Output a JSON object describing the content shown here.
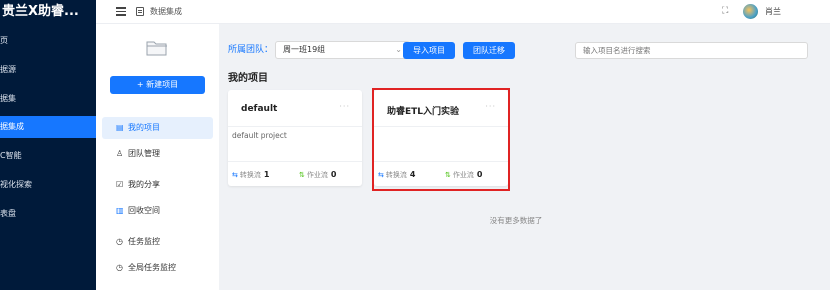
{
  "sidebar": {
    "brand": "贵兰X助睿...",
    "items": [
      {
        "label": "页"
      },
      {
        "label": "据源"
      },
      {
        "label": "据集"
      },
      {
        "label": "据集成"
      },
      {
        "label": "C智能"
      },
      {
        "label": "视化探索"
      },
      {
        "label": "表盘"
      }
    ]
  },
  "header": {
    "title": "数据集成",
    "user_name": "肖兰"
  },
  "subnav": {
    "new_project_label": "+ 新建项目",
    "items": [
      {
        "label": "我的项目",
        "icon": "project-icon"
      },
      {
        "label": "团队管理",
        "icon": "user-icon"
      },
      {
        "label": "我的分享",
        "icon": "share-icon"
      },
      {
        "label": "回收空间",
        "icon": "trash-icon"
      },
      {
        "label": "任务监控",
        "icon": "clock-icon"
      },
      {
        "label": "全局任务监控",
        "icon": "clock-icon"
      }
    ]
  },
  "main": {
    "team_label": "所属团队：",
    "team_value": "周一班19组",
    "import_button": "导入项目",
    "migrate_button": "团队迁移",
    "search_placeholder": "输入项目名进行搜索",
    "section_title": "我的项目",
    "no_more_text": "没有更多数据了",
    "cards": [
      {
        "title": "default",
        "more": "···",
        "description": "default project",
        "flow_label": "转换流",
        "flow_count": "1",
        "job_label": "作业流",
        "job_count": "0"
      },
      {
        "title": "助睿ETL入门实验",
        "more": "···",
        "description": "",
        "flow_label": "转换流",
        "flow_count": "4",
        "job_label": "作业流",
        "job_count": "0"
      }
    ]
  },
  "colors": {
    "sidebar_bg": "#001a3a",
    "accent": "#1677ff",
    "highlight_border": "#e02323"
  }
}
